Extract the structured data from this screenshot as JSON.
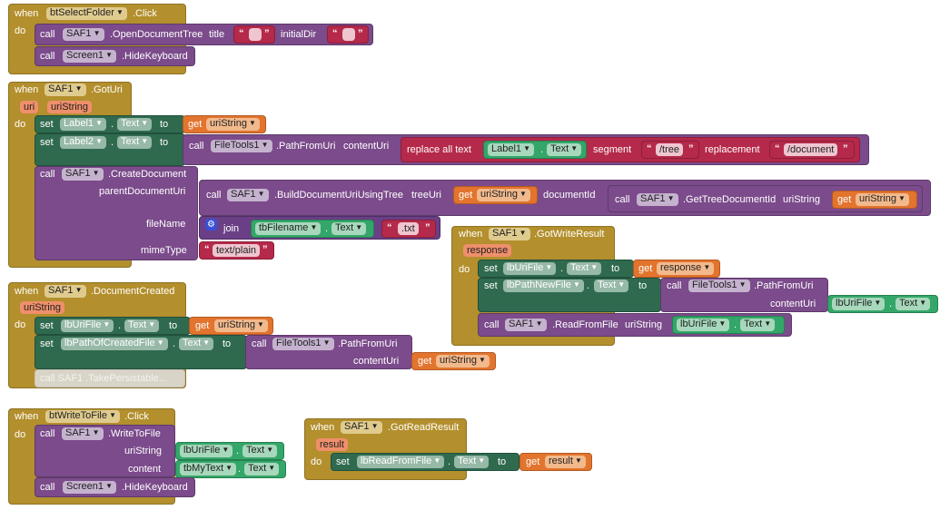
{
  "kw": {
    "when": "when",
    "do": "do",
    "call": "call",
    "set": "set",
    "to": "to",
    "get": "get",
    "join": "join",
    "replace_all_text": "replace all text",
    "segment": "segment",
    "replacement": "replacement",
    "dot": "."
  },
  "blocks": {
    "sel": {
      "component": "btSelectFolder",
      "event": ".Click",
      "c1_comp": "SAF1",
      "c1_method": ".OpenDocumentTree",
      "p_title": "title",
      "p_initial": "initialDir",
      "c2_comp": "Screen1",
      "c2_method": ".HideKeyboard"
    },
    "goturi": {
      "component": "SAF1",
      "event": ".GotUri",
      "param1": "uri",
      "param2": "uriString",
      "s1_comp": "Label1",
      "s1_prop": "Text",
      "s1_get": "uriString",
      "s2_comp": "Label2",
      "s2_prop": "Text",
      "ft_comp": "FileTools1",
      "ft_method": ".PathFromUri",
      "ft_param": "contentUri",
      "rep_comp": "Label1",
      "rep_prop": "Text",
      "seg_value": "/tree",
      "rep_value": "/document",
      "cd_comp": "SAF1",
      "cd_method": ".CreateDocument",
      "cd_p1": "parentDocumentUri",
      "cd_p2": "fileName",
      "cd_p3": "mimeType",
      "bu_comp": "SAF1",
      "bu_method": ".BuildDocumentUriUsingTree",
      "bu_p1": "treeUri",
      "bu_get": "uriString",
      "bu_p2": "documentId",
      "gt_comp": "SAF1",
      "gt_method": ".GetTreeDocumentId",
      "gt_p": "uriString",
      "gt_get": "uriString",
      "join_comp": "tbFilename",
      "join_prop": "Text",
      "join_str": ".txt",
      "mime": "text/plain"
    },
    "gwr": {
      "component": "SAF1",
      "event": ".GotWriteResult",
      "param": "response",
      "s1_comp": "lbUriFile",
      "s1_prop": "Text",
      "s1_get": "response",
      "s2_comp": "lbPathNewFile",
      "s2_prop": "Text",
      "ft_comp": "FileTools1",
      "ft_method": ".PathFromUri",
      "ft_param": "contentUri",
      "ft_arg_comp": "lbUriFile",
      "ft_arg_prop": "Text",
      "rf_comp": "SAF1",
      "rf_method": ".ReadFromFile",
      "rf_param": "uriString",
      "rf_arg_comp": "lbUriFile",
      "rf_arg_prop": "Text"
    },
    "dc": {
      "component": "SAF1",
      "event": ".DocumentCreated",
      "param": "uriString",
      "s1_comp": "lbUriFile",
      "s1_prop": "Text",
      "s1_get": "uriString",
      "s2_comp": "lbPathOfCreatedFile",
      "s2_prop": "Text",
      "ft_comp": "FileTools1",
      "ft_method": ".PathFromUri",
      "ft_param": "contentUri",
      "ft_get": "uriString",
      "disabled": "call  SAF1  .TakePersistable..."
    },
    "wr": {
      "component": "btWriteToFile",
      "event": ".Click",
      "c1_comp": "SAF1",
      "c1_method": ".WriteToFile",
      "p1": "uriString",
      "p2": "content",
      "a1_comp": "lbUriFile",
      "a1_prop": "Text",
      "a2_comp": "tbMyText",
      "a2_prop": "Text",
      "c2_comp": "Screen1",
      "c2_method": ".HideKeyboard"
    },
    "grr": {
      "component": "SAF1",
      "event": ".GotReadResult",
      "param": "result",
      "s_comp": "lbReadFromFile",
      "s_prop": "Text",
      "s_get": "result"
    }
  }
}
